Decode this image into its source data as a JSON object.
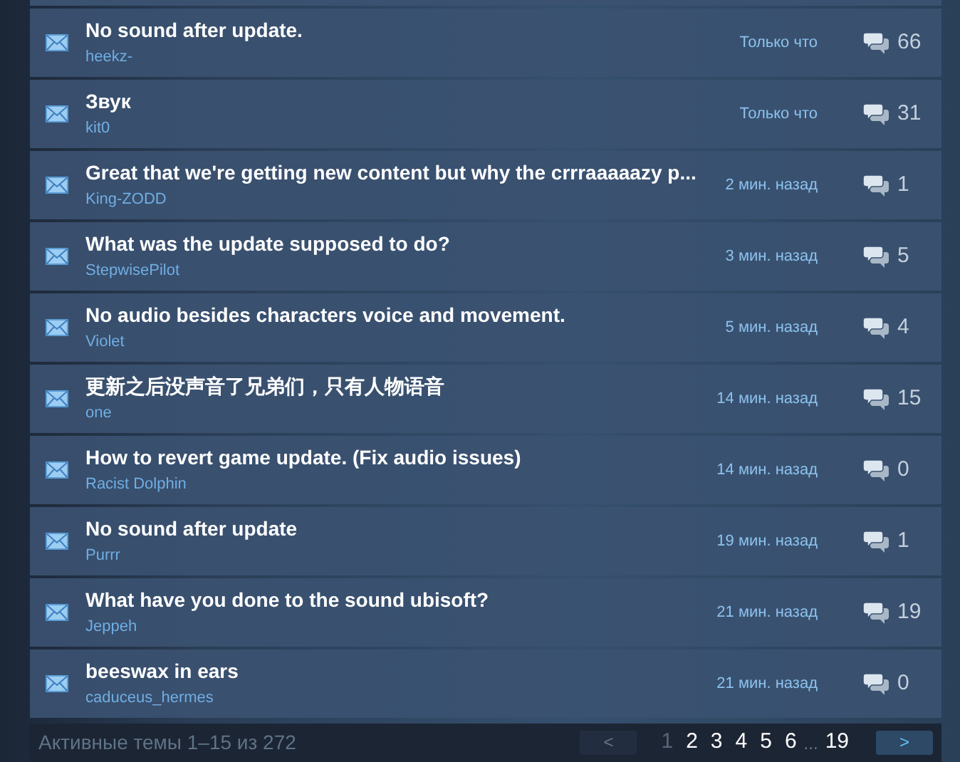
{
  "topics": [
    {
      "title": "No sound after update.",
      "author": "heekz-",
      "time": "Только что",
      "replies": "66"
    },
    {
      "title": "Звук",
      "author": "kit0",
      "time": "Только что",
      "replies": "31"
    },
    {
      "title": "Great that we're getting new content but why the crrraaaaazy p...",
      "author": "King-ZODD",
      "time": "2 мин. назад",
      "replies": "1"
    },
    {
      "title": "What was the update supposed to do?",
      "author": "StepwisePilot",
      "time": "3 мин. назад",
      "replies": "5"
    },
    {
      "title": "No audio besides characters voice and movement.",
      "author": "Violet",
      "time": "5 мин. назад",
      "replies": "4"
    },
    {
      "title": "更新之后没声音了兄弟们，只有人物语音",
      "author": "one",
      "time": "14 мин. назад",
      "replies": "15"
    },
    {
      "title": "How to revert game update. (Fix audio issues)",
      "author": "Racist Dolphin",
      "time": "14 мин. назад",
      "replies": "0"
    },
    {
      "title": "No sound after update",
      "author": "Purrr",
      "time": "19 мин. назад",
      "replies": "1"
    },
    {
      "title": "What have you done to the sound ubisoft?",
      "author": "Jeppeh",
      "time": "21 мин. назад",
      "replies": "19"
    },
    {
      "title": "beeswax in ears",
      "author": "caduceus_hermes",
      "time": "21 мин. назад",
      "replies": "0"
    }
  ],
  "footer": {
    "summary": "Активные темы 1–15 из 272",
    "prev": {
      "label": "<",
      "disabled": true
    },
    "pages": [
      {
        "label": "1",
        "selected": true
      },
      {
        "label": "2",
        "selected": false
      },
      {
        "label": "3",
        "selected": false
      },
      {
        "label": "4",
        "selected": false
      },
      {
        "label": "5",
        "selected": false
      },
      {
        "label": "6",
        "selected": false
      }
    ],
    "ellipsis": "...",
    "last_page": "19",
    "next": {
      "label": ">",
      "disabled": false
    }
  }
}
